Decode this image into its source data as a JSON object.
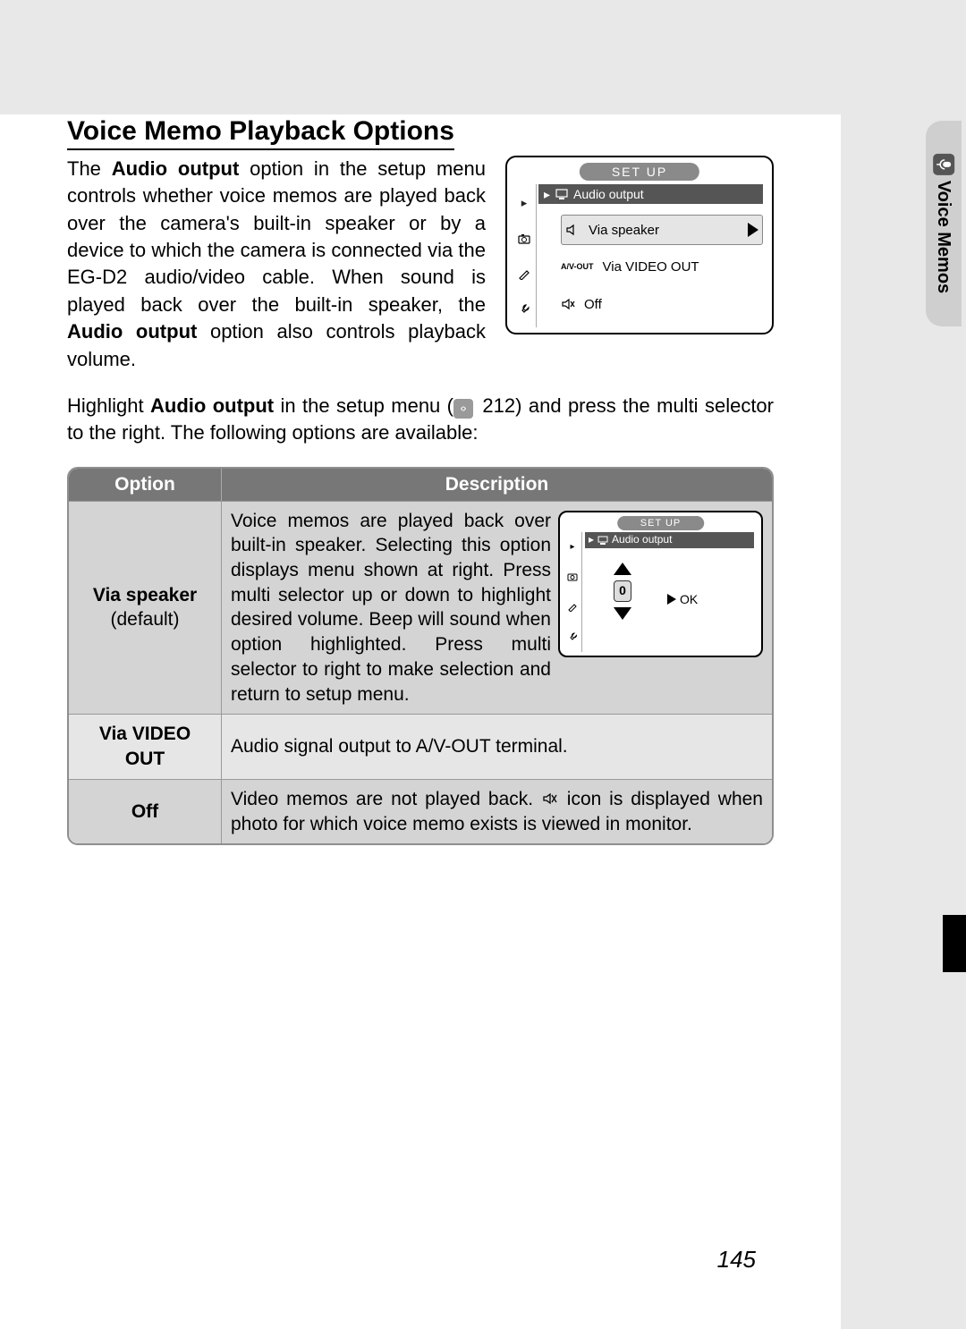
{
  "heading": "Voice Memo Playback Options",
  "intro_parts": {
    "p1a": "The ",
    "p1b": "Audio output",
    "p1c": " option in the setup menu controls whether voice memos are played back over the camera's built-in speaker or by a device to which the camera is connected via the EG-D2 audio/video cable.  When sound is played back over the built-in speaker, the ",
    "p1d": "Audio output",
    "p1e": " op­tion also controls playback volume."
  },
  "para2_parts": {
    "a": "Highlight ",
    "b": "Audio output",
    "c": " in the setup menu (",
    "d": " 212) and press the multi selector to the right.  The following options are available:"
  },
  "screen1": {
    "title": "SET  UP",
    "sub": "Audio output",
    "options": [
      "Via speaker",
      "Via VIDEO OUT",
      "Off"
    ],
    "icon2": "A/V-OUT"
  },
  "table": {
    "headers": [
      "Option",
      "Description"
    ],
    "rows": [
      {
        "opt_strong": "Via speaker",
        "opt_sub": "(default)",
        "desc": "Voice memos are played back over built-in speaker.  Selecting this option displays menu shown at right.  Press multi selector up or down to highlight desired volume.  Beep will sound when option highlighted.  Press multi selector to right to make selection and return to setup menu.",
        "screen": {
          "title": "SET  UP",
          "sub": "Audio output",
          "value": "0",
          "ok": "OK"
        }
      },
      {
        "opt_strong": "Via VIDEO OUT",
        "opt_sub": "",
        "desc": "Audio signal output to A/V-OUT terminal."
      },
      {
        "opt_strong": "Off",
        "opt_sub": "",
        "desc_a": "Video memos are not played back.  ",
        "desc_b": " icon is displayed when photo for which voice memo exists is viewed in monitor."
      }
    ]
  },
  "sidetab": "Voice Memos",
  "pagenum": "145"
}
